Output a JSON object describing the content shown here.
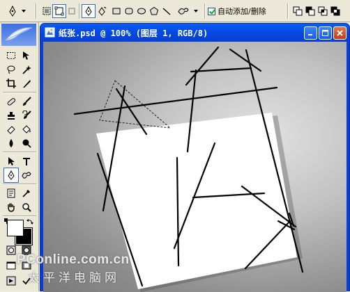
{
  "options_bar": {
    "auto_add_delete": {
      "label": "自动添加/删除",
      "checked": true
    }
  },
  "document": {
    "title": "纸张.psd @ 100% (图层 1, RGB/8)"
  },
  "watermark": {
    "line1": "PConline.com.cn",
    "line2": "太平洋电脑网"
  },
  "colors": {
    "titlebar": "#0a55e8",
    "window_chrome": "#ece9d8",
    "canvas_gray": "#9a9a9a",
    "paper": "#ffffff",
    "close_button": "#d6532e"
  },
  "icons": {
    "options_bar": [
      "pen-tool-icon",
      "shape-layers-icon",
      "paths-icon",
      "fill-pixels-icon",
      "pen-icon",
      "freeform-pen-icon",
      "rectangle-icon",
      "rounded-rectangle-icon",
      "ellipse-icon",
      "polygon-icon",
      "line-icon",
      "custom-shape-icon",
      "path-add-icon",
      "path-subtract-icon",
      "path-intersect-icon",
      "path-exclude-icon"
    ],
    "toolbox": [
      "marquee-icon",
      "move-icon",
      "lasso-icon",
      "magic-wand-icon",
      "crop-icon",
      "slice-icon",
      "healing-brush-icon",
      "brush-icon",
      "clone-stamp-icon",
      "history-brush-icon",
      "eraser-icon",
      "paint-bucket-icon",
      "blur-icon",
      "dodge-icon",
      "path-selection-icon",
      "type-icon",
      "pen-icon",
      "custom-shape-icon",
      "notes-icon",
      "eyedropper-icon",
      "hand-icon",
      "zoom-icon",
      "swap-colors-icon",
      "standard-mode-icon",
      "quick-mask-icon",
      "screen-mode-icon",
      "jump-to-imageready-icon"
    ]
  }
}
